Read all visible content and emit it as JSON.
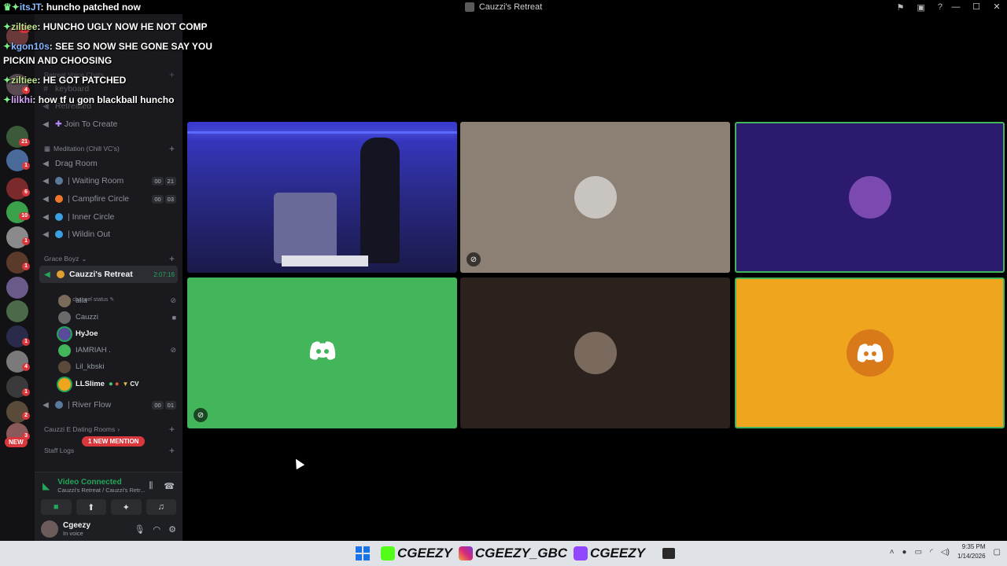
{
  "window": {
    "title": "Cauzzi's Retreat",
    "controls": [
      "—",
      "☐",
      "✕"
    ],
    "icons": [
      "inbox-icon",
      "screen-icon",
      "help-icon"
    ]
  },
  "chat_overlay": [
    {
      "user": "itsJT",
      "text": "huncho patched now"
    },
    {
      "user": "ziltiee",
      "text": "HUNCHO UGLY NOW HE NOT COMP"
    },
    {
      "user": "kgon10s",
      "text": "SEE SO NOW SHE GONE SAY YOU"
    },
    {
      "user": "",
      "text": "PICKIN AND CHOOSING"
    },
    {
      "user": "ziltiee",
      "text": "HE GOT PATCHED"
    },
    {
      "user": "lilkhi",
      "text": "how tf u gon blackball huncho"
    }
  ],
  "server_rail": {
    "badges": [
      "19",
      "4",
      "21",
      "1",
      "6",
      "10",
      "1",
      "1",
      "1",
      "4",
      "1",
      "2",
      "3"
    ],
    "new_label": "NEW"
  },
  "sidebar": {
    "partial_channels": [
      "keyboard",
      "Retreated"
    ],
    "partial_category": "Retreat Voice Chats",
    "join_to_create": "Join To Create",
    "meditation_category": "Meditation (Chill VC's)",
    "meditation_channels": [
      {
        "name": "Drag Room",
        "counts": []
      },
      {
        "name": "| Waiting Room",
        "counts": [
          "00",
          "21"
        ]
      },
      {
        "name": "| Campfire Circle",
        "counts": [
          "00",
          "03"
        ]
      },
      {
        "name": "| Inner Circle",
        "counts": []
      },
      {
        "name": "| Wildin Out",
        "counts": []
      }
    ],
    "grace_category": "Grace Boyz",
    "active_channel": {
      "name": "Cauzzi's Retreat",
      "timer": "2:07:16",
      "status": "Set a channel status"
    },
    "voice_users": [
      {
        "name": "alia",
        "right": "mute-icon"
      },
      {
        "name": "Cauzzi",
        "right": "camera-icon"
      },
      {
        "name": "HyJoe",
        "right": ""
      },
      {
        "name": "IAMRIAH .",
        "right": "mute-icon"
      },
      {
        "name": "Lil_kbski",
        "right": ""
      },
      {
        "name": "LLSlime",
        "right": "",
        "tag": "CV"
      }
    ],
    "river_flow": {
      "name": "| River Flow",
      "counts": [
        "00",
        "01"
      ]
    },
    "dating_category": "Cauzzi E Dating Rooms",
    "staff_category": "Staff Logs",
    "mention_pill": "1 NEW MENTION"
  },
  "voice_panel": {
    "title": "Video Connected",
    "subtitle": "Cauzzi's Retreat / Cauzzi's Retr..."
  },
  "user_panel": {
    "username": "Cgeezy",
    "status": "In voice"
  },
  "tiles": [
    {
      "label": "video-camera-feed",
      "bg": "#2a2a9a"
    },
    {
      "label": "avatar-tile-2",
      "bg": "#8c7f73"
    },
    {
      "label": "avatar-tile-3",
      "bg": "#2c1a6e"
    },
    {
      "label": "discord-default-avatar-tile",
      "bg": "#43b55a"
    },
    {
      "label": "avatar-tile-5",
      "bg": "#2b211d"
    },
    {
      "label": "discord-pumpkin-avatar-tile",
      "bg": "#f0a51f"
    }
  ],
  "taskbar": {
    "handles": [
      "CGEEZY",
      "CGEEZY_GBC",
      "CGEEZY"
    ],
    "time": "9:35 PM",
    "date": "1/14/2026"
  }
}
